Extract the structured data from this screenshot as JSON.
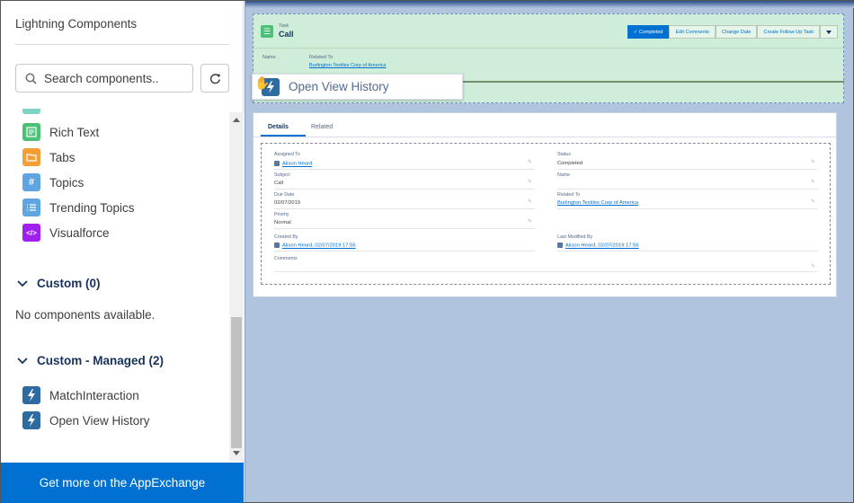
{
  "panel": {
    "title": "Lightning Components",
    "search_placeholder": "Search components..",
    "components": [
      {
        "label": "Rich Text",
        "icon": "rich-text-icon",
        "color": "#4bc076"
      },
      {
        "label": "Tabs",
        "icon": "folder-icon",
        "color": "#f59e36"
      },
      {
        "label": "Topics",
        "icon": "hash-icon",
        "color": "#5fa5e1"
      },
      {
        "label": "Trending Topics",
        "icon": "list-icon",
        "color": "#5fa5e1"
      },
      {
        "label": "Visualforce",
        "icon": "code-icon",
        "color": "#a020f0"
      }
    ],
    "custom_section": {
      "label": "Custom (0)",
      "empty_text": "No components available."
    },
    "managed_section": {
      "label": "Custom - Managed (2)",
      "items": [
        {
          "label": "MatchInteraction",
          "icon": "bolt-icon",
          "color": "#2e6ba1"
        },
        {
          "label": "Open View History",
          "icon": "bolt-icon",
          "color": "#2e6ba1"
        }
      ]
    },
    "appexchange_label": "Get more on the AppExchange"
  },
  "canvas": {
    "record": {
      "type_label": "Task",
      "title": "Call",
      "buttons": [
        "✓ Completed",
        "Edit Comments",
        "Change Date",
        "Create Follow-Up Task"
      ],
      "name_label": "Name",
      "related_label": "Related To",
      "related_value": "Burlington Textiles Corp of America"
    },
    "drag_item": "Open View History",
    "tabs": [
      "Details",
      "Related"
    ],
    "fields": {
      "assigned_to_label": "Assigned To",
      "assigned_to_value": "Alison Heard",
      "status_label": "Status",
      "status_value": "Completed",
      "subject_label": "Subject",
      "subject_value": "Call",
      "name_label": "Name",
      "due_date_label": "Due Date",
      "due_date_value": "02/07/2019",
      "related_to_label": "Related To",
      "related_to_value": "Burlington Textiles Corp of America",
      "priority_label": "Priority",
      "priority_value": "Normal",
      "created_by_label": "Created By",
      "created_by_value": "Alison Heard, 02/07/2019 17:56",
      "last_modified_label": "Last Modified By",
      "last_modified_value": "Alison Heard, 02/07/2019 17:56",
      "comments_label": "Comments"
    }
  },
  "colors": {
    "accent": "#0070d2",
    "canvas_bg": "#b0c4de",
    "record_bg": "#cfeed9"
  }
}
